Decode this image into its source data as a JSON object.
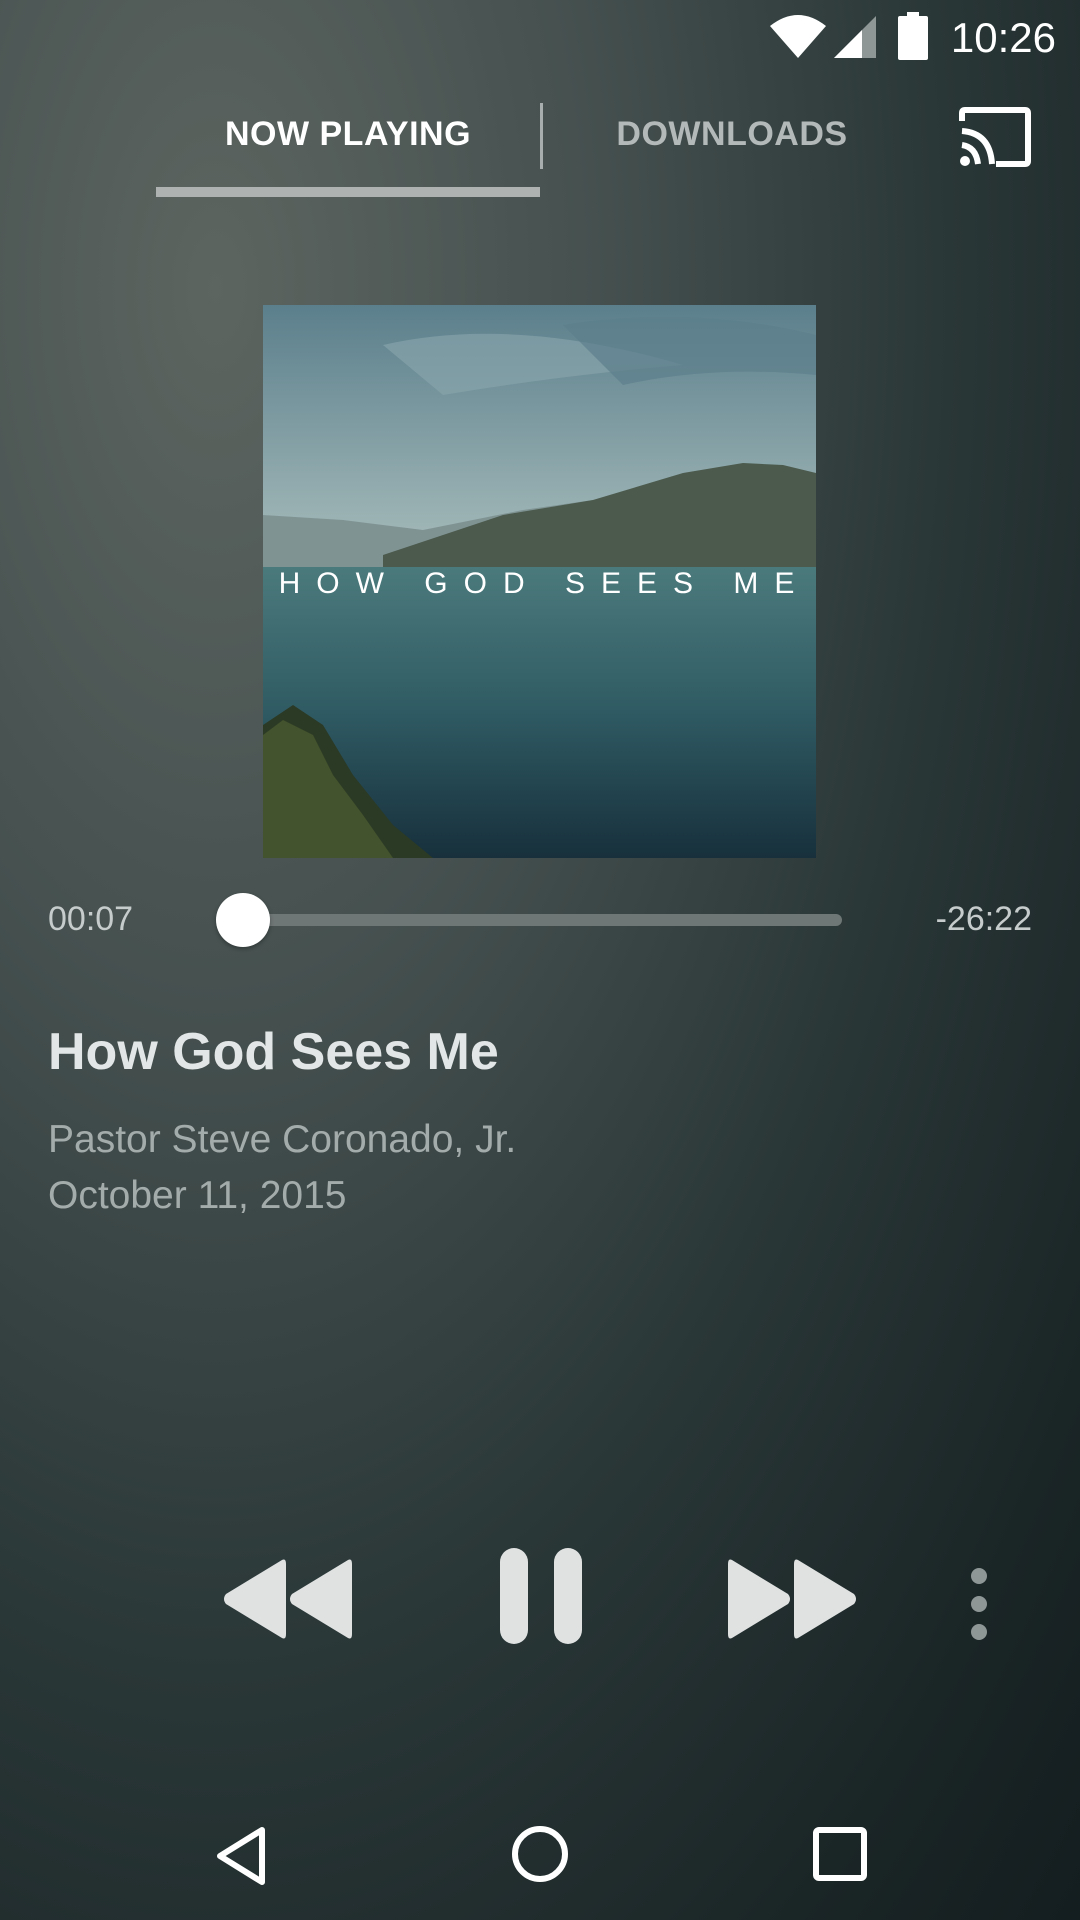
{
  "status_bar": {
    "time": "10:26",
    "icons": [
      "wifi-icon",
      "signal-icon",
      "battery-icon"
    ]
  },
  "tabs": [
    {
      "label": "NOW PLAYING",
      "active": true
    },
    {
      "label": "DOWNLOADS",
      "active": false
    }
  ],
  "header": {
    "cast_icon": "cast-icon"
  },
  "album_art": {
    "title_text": "HOW GOD SEES ME"
  },
  "player": {
    "elapsed": "00:07",
    "remaining": "-26:22",
    "progress": 0.005
  },
  "track": {
    "title": "How God Sees Me",
    "artist": "Pastor Steve Coronado, Jr.",
    "date": "October 11, 2015"
  },
  "controls": {
    "icons": [
      "rewind-icon",
      "pause-icon",
      "fast-forward-icon",
      "more-vert-icon"
    ]
  },
  "nav_bar": {
    "icons": [
      "back-icon",
      "home-icon",
      "recent-apps-icon"
    ]
  },
  "colors": {
    "accent": "#ffffff",
    "background_top": "#5d6560",
    "background_bottom": "#141d1f"
  }
}
